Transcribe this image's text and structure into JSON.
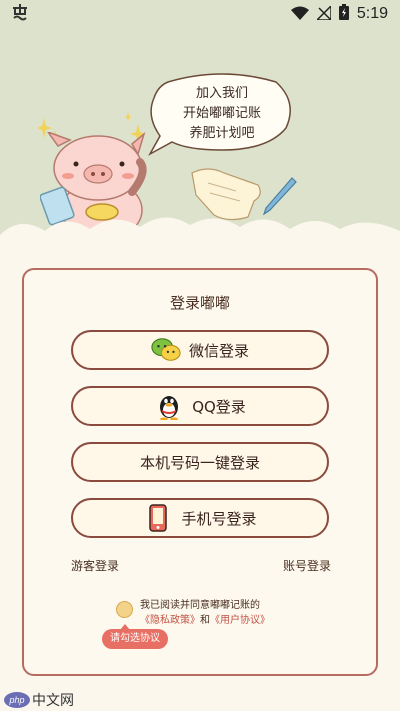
{
  "status_bar": {
    "time": "5:19"
  },
  "hero": {
    "bubble_lines": [
      "加入我们",
      "开始嘟嘟记账",
      "养肥计划吧"
    ]
  },
  "card": {
    "title": "登录嘟嘟",
    "buttons": {
      "wechat": "微信登录",
      "qq": "QQ登录",
      "one_click": "本机号码一键登录",
      "phone": "手机号登录"
    },
    "guest_login": "游客登录",
    "account_login": "账号登录",
    "agreement": {
      "prefix": "我已阅读并同意嘟嘟记账的",
      "privacy": "《隐私政策》",
      "and": "和",
      "user": "《用户协议》"
    },
    "tip": "请勾选协议"
  },
  "watermark": {
    "badge": "php",
    "text": "中文网"
  },
  "colors": {
    "hero_bg": "#dde2cc",
    "page_bg": "#fbf7ec",
    "card_border": "#b56b5e",
    "button_border": "#8a4a3e",
    "link_red": "#c45345",
    "tip_bg": "#e86f63"
  }
}
